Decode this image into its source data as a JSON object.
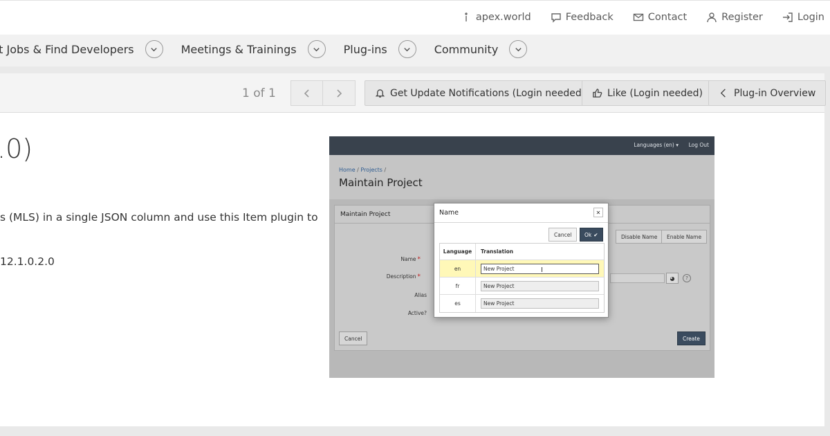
{
  "topbar": {
    "links": [
      {
        "label": "apex.world",
        "icon": "info-icon"
      },
      {
        "label": "Feedback",
        "icon": "chat-icon"
      },
      {
        "label": "Contact",
        "icon": "mail-icon"
      },
      {
        "label": "Register",
        "icon": "user-icon"
      },
      {
        "label": "Login",
        "icon": "login-icon"
      }
    ]
  },
  "nav": {
    "items": [
      {
        "label": "ost Jobs & Find Developers"
      },
      {
        "label": "Meetings & Trainings"
      },
      {
        "label": "Plug-ins"
      },
      {
        "label": "Community"
      }
    ]
  },
  "toolbar": {
    "pager": "1 of 1",
    "notify_label": "Get Update Notifications (Login needed)",
    "like_label": "Like (Login needed)",
    "overview_label": "Plug-in Overview"
  },
  "content": {
    "title_fragment": ".0)",
    "description_fragment": "s (MLS) in a single JSON column and use this Item plugin to",
    "version_fragment": "12.1.0.2.0"
  },
  "screenshot": {
    "languages": "Languages (en) ▾",
    "logout": "Log Out",
    "breadcrumb_home": "Home",
    "breadcrumb_projects": "Projects",
    "page_title": "Maintain Project",
    "region_title": "Maintain Project",
    "disable_name": "Disable Name",
    "enable_name": "Enable Name",
    "labels": {
      "name": "Name",
      "description": "Description",
      "alias": "Alias",
      "active": "Active?"
    },
    "cancel": "Cancel",
    "create": "Create",
    "dialog": {
      "title": "Name",
      "cancel": "Cancel",
      "ok": "Ok",
      "col_language": "Language",
      "col_translation": "Translation",
      "rows": [
        {
          "lang": "en",
          "value": "New Project"
        },
        {
          "lang": "fr",
          "value": "New Project"
        },
        {
          "lang": "es",
          "value": "New Project"
        }
      ]
    }
  }
}
